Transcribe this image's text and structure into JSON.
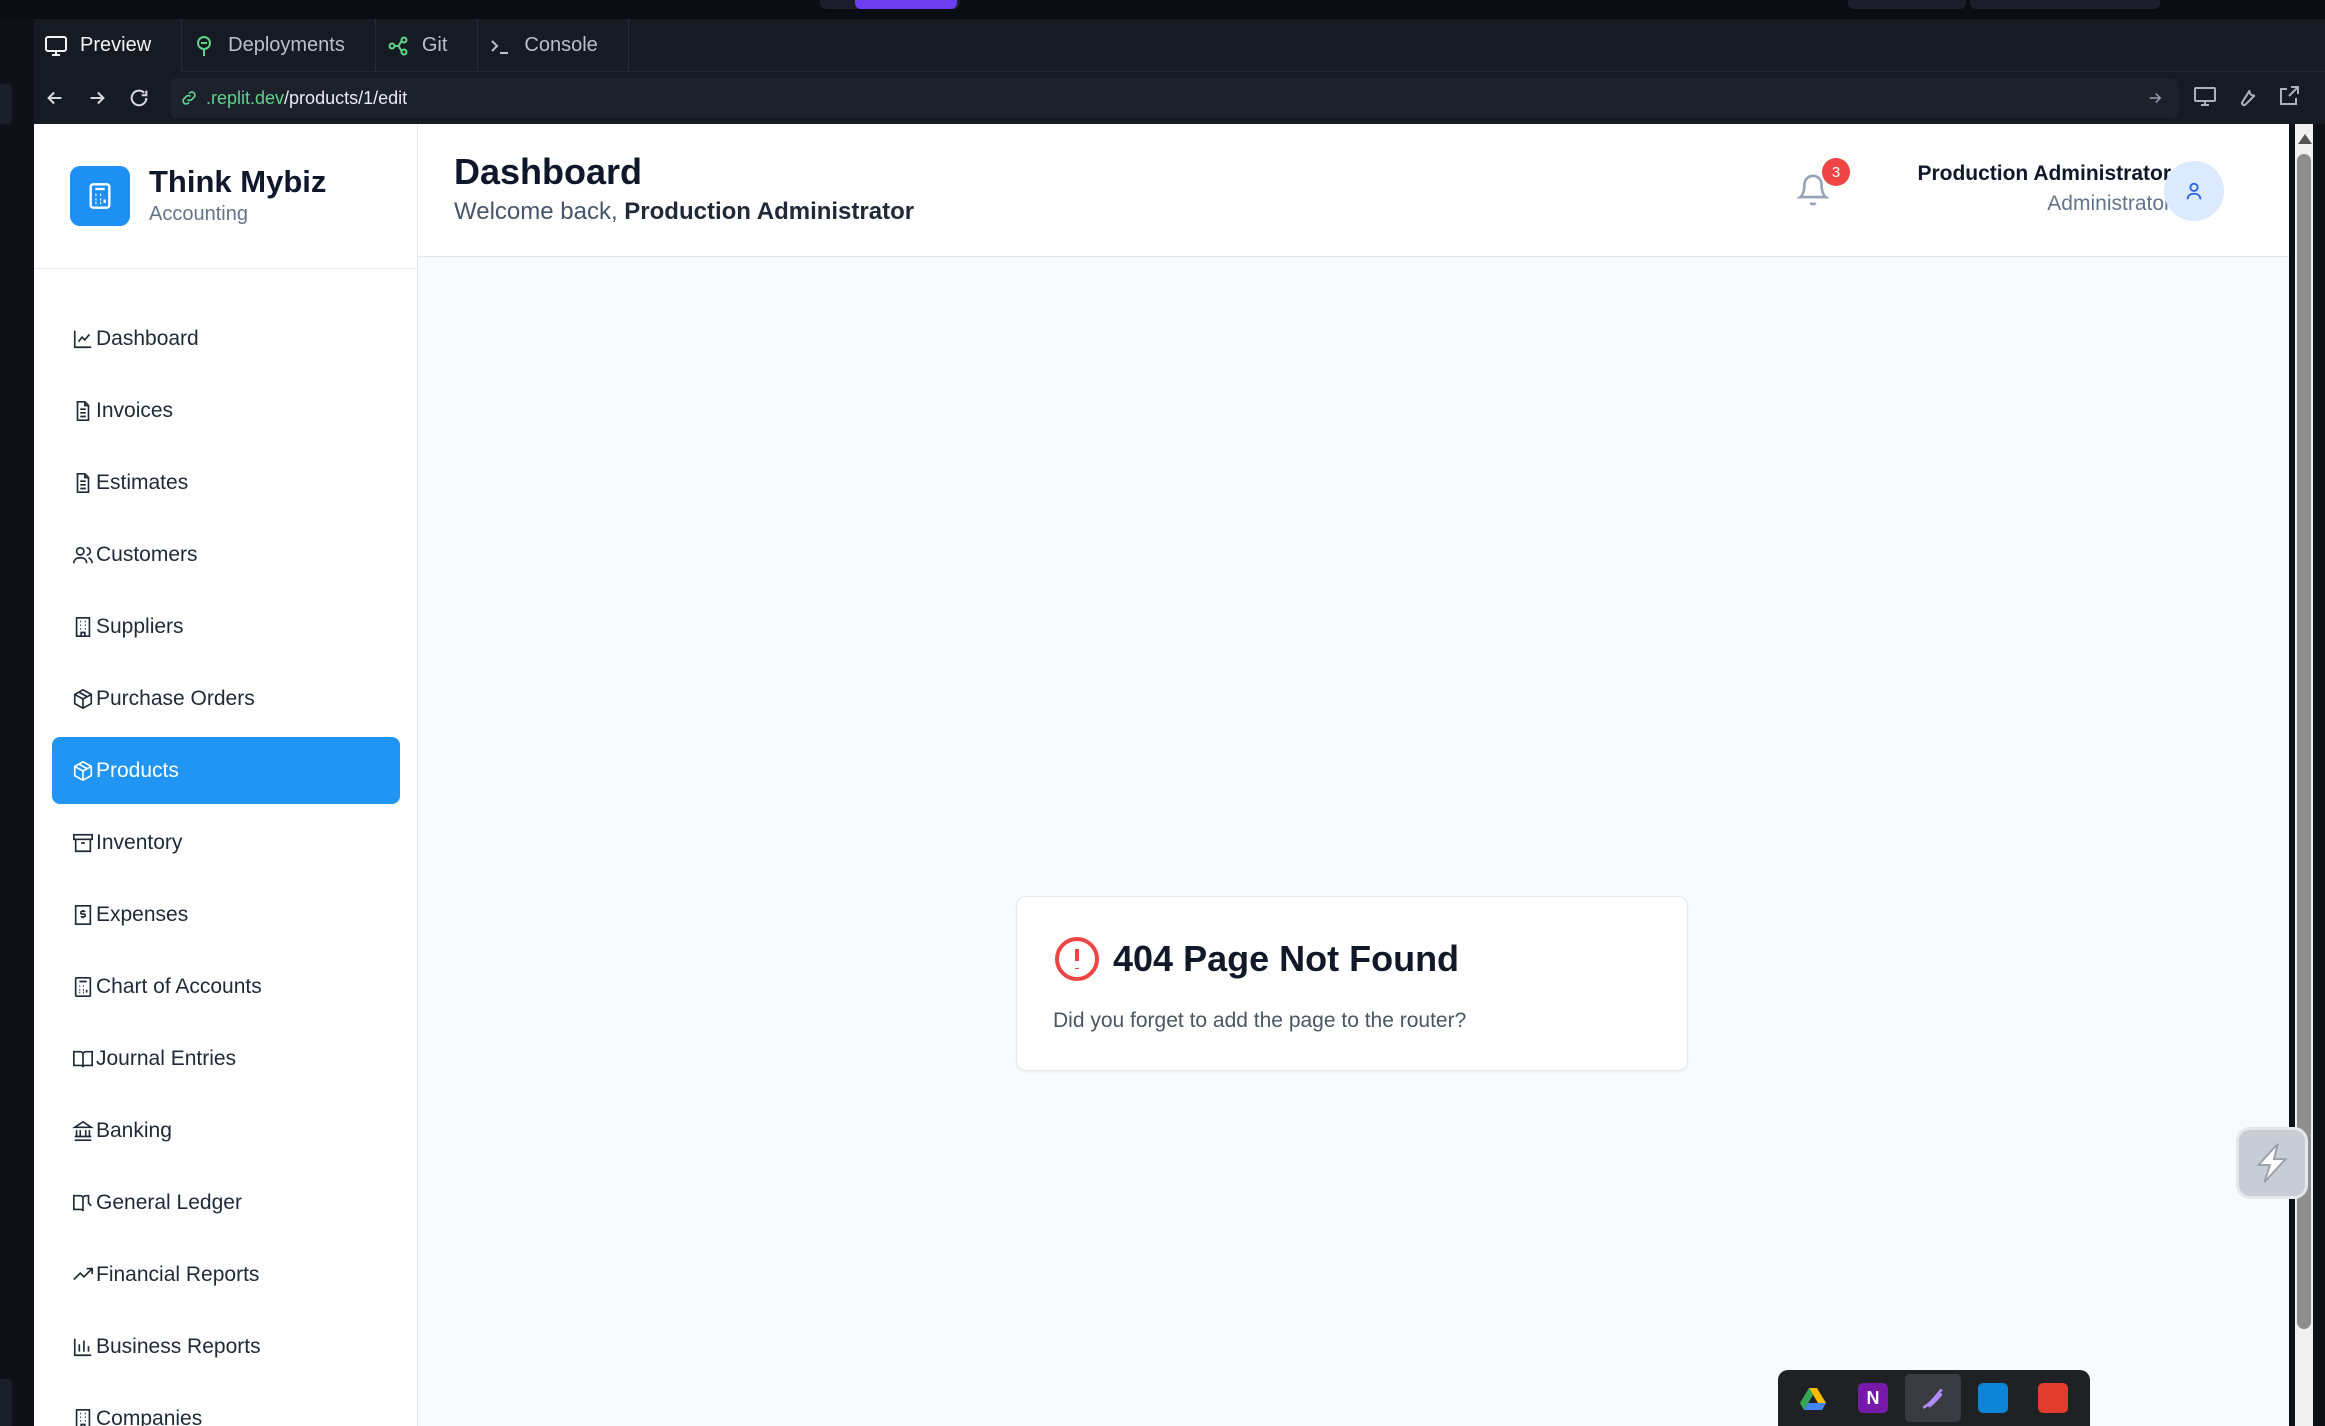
{
  "ide": {
    "tabs": [
      {
        "label": "Preview",
        "icon": "monitor-icon"
      },
      {
        "label": "Deployments",
        "icon": "deploy-icon"
      },
      {
        "label": "Git",
        "icon": "git-icon"
      },
      {
        "label": "Console",
        "icon": "terminal-icon"
      }
    ],
    "url": {
      "domain": ".replit.dev",
      "path": "/products/1/edit"
    }
  },
  "app": {
    "brand": {
      "name": "Think Mybiz",
      "subtitle": "Accounting"
    },
    "nav": [
      {
        "label": "Dashboard",
        "icon": "chart-line-icon",
        "active": false
      },
      {
        "label": "Invoices",
        "icon": "file-text-icon",
        "active": false
      },
      {
        "label": "Estimates",
        "icon": "file-text-icon",
        "active": false
      },
      {
        "label": "Customers",
        "icon": "users-icon",
        "active": false
      },
      {
        "label": "Suppliers",
        "icon": "building-icon",
        "active": false
      },
      {
        "label": "Purchase Orders",
        "icon": "package-icon",
        "active": false
      },
      {
        "label": "Products",
        "icon": "package-icon",
        "active": true
      },
      {
        "label": "Inventory",
        "icon": "archive-icon",
        "active": false
      },
      {
        "label": "Expenses",
        "icon": "receipt-icon",
        "active": false
      },
      {
        "label": "Chart of Accounts",
        "icon": "calculator-icon",
        "active": false
      },
      {
        "label": "Journal Entries",
        "icon": "book-open-icon",
        "active": false
      },
      {
        "label": "Banking",
        "icon": "landmark-icon",
        "active": false
      },
      {
        "label": "General Ledger",
        "icon": "book-icon",
        "active": false
      },
      {
        "label": "Financial Reports",
        "icon": "trending-up-icon",
        "active": false
      },
      {
        "label": "Business Reports",
        "icon": "bar-chart-icon",
        "active": false
      },
      {
        "label": "Companies",
        "icon": "building-icon",
        "active": false
      }
    ],
    "header": {
      "title": "Dashboard",
      "welcome_prefix": "Welcome back,",
      "welcome_name": "Production Administrator",
      "notification_count": "3",
      "user_name": "Production Administrator",
      "user_role": "Administrator"
    },
    "error": {
      "heading": "404 Page Not Found",
      "message": "Did you forget to add the page to the router?"
    }
  },
  "colors": {
    "accent": "#2195f3",
    "error": "#ef4444",
    "link_domain": "#5fd38a"
  }
}
